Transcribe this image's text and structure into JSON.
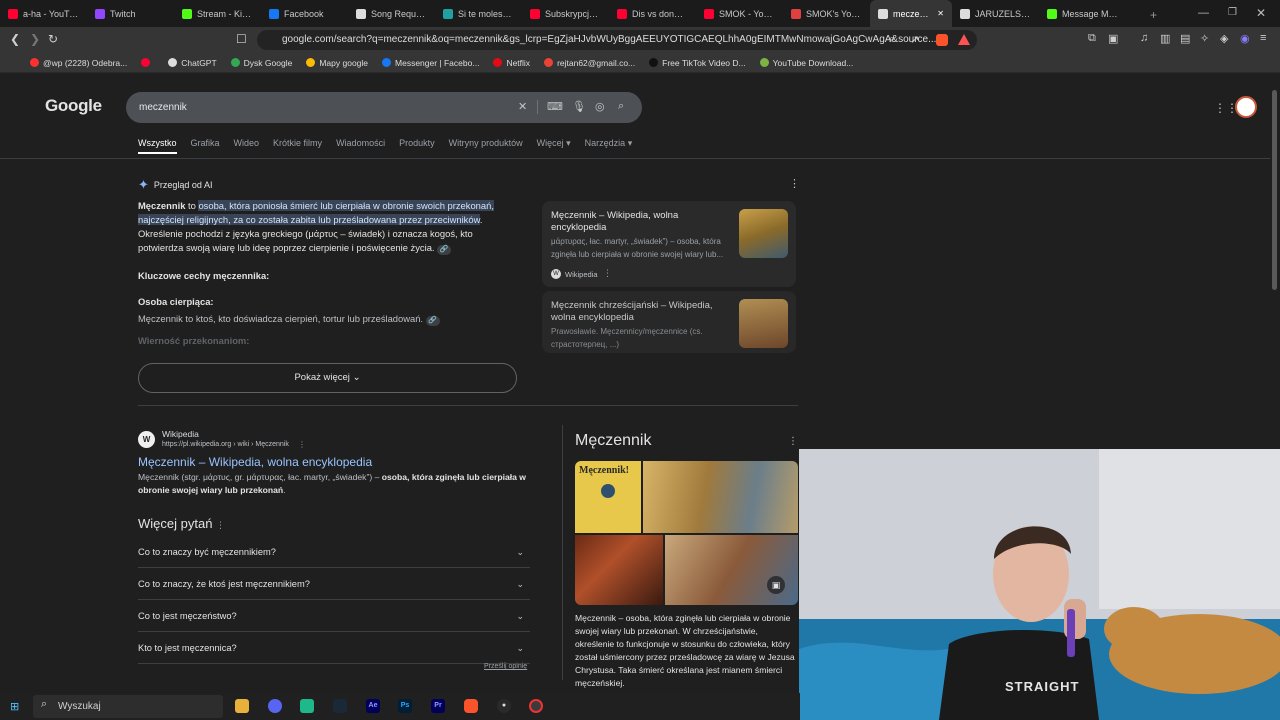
{
  "tabs": [
    {
      "label": "a-ha - YouTube",
      "color": "#ff0033"
    },
    {
      "label": "Twitch",
      "color": "#9146ff"
    },
    {
      "label": "Stream - Kick D",
      "color": "#53fc18"
    },
    {
      "label": "Facebook",
      "color": "#1877f2"
    },
    {
      "label": "Song Requests",
      "color": "#dddddd"
    },
    {
      "label": "Si te molesta c",
      "color": "#20a0a0"
    },
    {
      "label": "Subskrypcje - Y",
      "color": "#ff0033"
    },
    {
      "label": "Dis vs donejty",
      "color": "#ff0033"
    },
    {
      "label": "SMOK - YouTu",
      "color": "#ff0033"
    },
    {
      "label": "SMOK's YouTu",
      "color": "#e04040"
    },
    {
      "label": "meczennik",
      "color": "#dddddd",
      "active": true
    },
    {
      "label": "JARUZELSKI - S",
      "color": "#dddddd"
    },
    {
      "label": "Message Mode",
      "color": "#53fc18"
    }
  ],
  "address": {
    "url": "google.com/search?q=meczennik&oq=meczennik&gs_lcrp=EgZjaHJvbWUyBggAEEUYOTIGCAEQLhhA0gEIMTMwNmowajGoAgCwAgA&source..."
  },
  "bookmarks": [
    {
      "label": "@wp (2228) Odebra...",
      "color": "#ff3030"
    },
    {
      "label": "",
      "color": "#ff0033"
    },
    {
      "label": "ChatGPT",
      "color": "#dddddd"
    },
    {
      "label": "Dysk Google",
      "color": "#34a853"
    },
    {
      "label": "Mapy google",
      "color": "#fbbc04"
    },
    {
      "label": "Messenger | Facebo...",
      "color": "#1877f2"
    },
    {
      "label": "Netflix",
      "color": "#e50914"
    },
    {
      "label": "rejtan62@gmail.co...",
      "color": "#ea4335"
    },
    {
      "label": "Free TikTok Video D...",
      "color": "#111111"
    },
    {
      "label": "YouTube Download...",
      "color": "#7cb342"
    }
  ],
  "google": {
    "logo": "Google",
    "query": "meczennik",
    "nav": [
      "Wszystko",
      "Grafika",
      "Wideo",
      "Krótkie filmy",
      "Wiadomości",
      "Produkty",
      "Witryny produktów",
      "Więcej ▾",
      "Narzędzia ▾"
    ],
    "ai": {
      "header": "Przegląd od AI",
      "term": "Męczennik",
      "to": " to ",
      "highlight": "osoba, która poniosła śmierć lub cierpiała w obronie swoich przekonań, najczęściej religijnych, za co została zabita lub prześladowana przez przeciwników",
      "dot": ".",
      "para2": "Określenie pochodzi z języka greckiego (μάρτυς – świadek) i oznacza kogoś, kto potwierdza swoją wiarę lub ideę poprzez cierpienie i poświęcenie życia.",
      "key_heading": "Kluczowe cechy męczennika:",
      "item1_title": "Osoba cierpiąca:",
      "item1_text": "Męczennik to ktoś, kto doświadcza cierpień, tortur lub prześladowań.",
      "item2_title": "Wierność przekonaniom:",
      "show_more": "Pokaż więcej"
    },
    "sources": [
      {
        "title": "Męczennik – Wikipedia, wolna encyklopedia",
        "desc": "μάρτυρας, łac. martyr, „świadek”) – osoba, która zginęła lub cierpiała w obronie swojej wiary lub...",
        "site": "Wikipedia"
      },
      {
        "title": "Męczennik chrześcijański – Wikipedia, wolna encyklopedia",
        "desc": "Prawosławie. Męczennicy/męczennice (cs. страстотерпец, ...)"
      }
    ],
    "result": {
      "site": "Wikipedia",
      "url": "https://pl.wikipedia.org › wiki › Męczennik",
      "title": "Męczennik – Wikipedia, wolna encyklopedia",
      "desc_a": "Męczennik (stgr. μάρτυς, gr. μάρτυρας, łac. martyr, „świadek”) – ",
      "desc_b": "osoba, która zginęła lub cierpiała w obronie swojej wiary lub przekonań",
      "desc_c": "."
    },
    "paa": {
      "title": "Więcej pytań",
      "questions": [
        "Co to znaczy być męczennikiem?",
        "Co to znaczy, że ktoś jest męczennikiem?",
        "Co to jest męczeństwo?",
        "Kto to jest męczennica?"
      ],
      "feedback": "Prześlij opinię"
    },
    "kp": {
      "title": "Męczennik",
      "img_text": "Męczennik!",
      "desc": "Męczennik – osoba, która zginęła lub cierpiała w obronie swojej wiary lub przekonań. W chrześcijaństwie, określenie to funkcjonuje w stosunku do człowieka, który został uśmiercony przez prześladowcę za wiarę w Jezusa Chrystusa. Taka śmierć określana jest mianem śmierci męczeńskiej."
    }
  },
  "webcam": {
    "shirt_text": "STRAIGHT"
  },
  "taskbar": {
    "search": "Wyszukaj",
    "apps": [
      "Ae",
      "Ps",
      "Pr"
    ]
  }
}
